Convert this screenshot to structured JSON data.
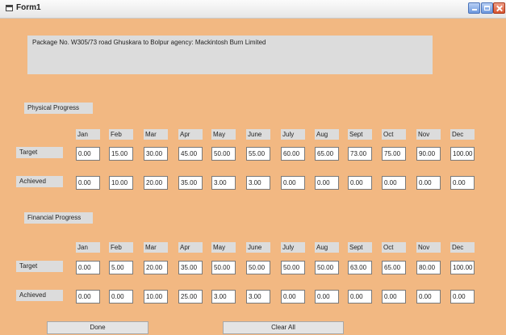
{
  "window": {
    "title": "Form1"
  },
  "package_info": "Package No.  W305/73   road   Ghuskara to Bolpur   agency:   Mackintosh Burn Limited",
  "months": [
    "Jan",
    "Feb",
    "Mar",
    "Apr",
    "May",
    "June",
    "July",
    "Aug",
    "Sept",
    "Oct",
    "Nov",
    "Dec"
  ],
  "physical": {
    "heading": "Physical Progress",
    "target_label": "Target",
    "achieved_label": "Achieved",
    "target": [
      "0.00",
      "15.00",
      "30.00",
      "45.00",
      "50.00",
      "55.00",
      "60.00",
      "65.00",
      "73.00",
      "75.00",
      "90.00",
      "100.00"
    ],
    "achieved": [
      "0.00",
      "10.00",
      "20.00",
      "35.00",
      "3.00",
      "3.00",
      "0.00",
      "0.00",
      "0.00",
      "0.00",
      "0.00",
      "0.00"
    ]
  },
  "financial": {
    "heading": "Financial Progress",
    "target_label": "Target",
    "achieved_label": "Achieved",
    "target": [
      "0.00",
      "5.00",
      "20.00",
      "35.00",
      "50.00",
      "50.00",
      "50.00",
      "50.00",
      "63.00",
      "65.00",
      "80.00",
      "100.00"
    ],
    "achieved": [
      "0.00",
      "0.00",
      "10.00",
      "25.00",
      "3.00",
      "3.00",
      "0.00",
      "0.00",
      "0.00",
      "0.00",
      "0.00",
      "0.00"
    ]
  },
  "buttons": {
    "done": "Done",
    "clear_all": "Clear All"
  },
  "icons": {
    "form": "form-icon",
    "minimize": "minimize-icon",
    "maximize": "maximize-icon",
    "close": "close-icon"
  }
}
